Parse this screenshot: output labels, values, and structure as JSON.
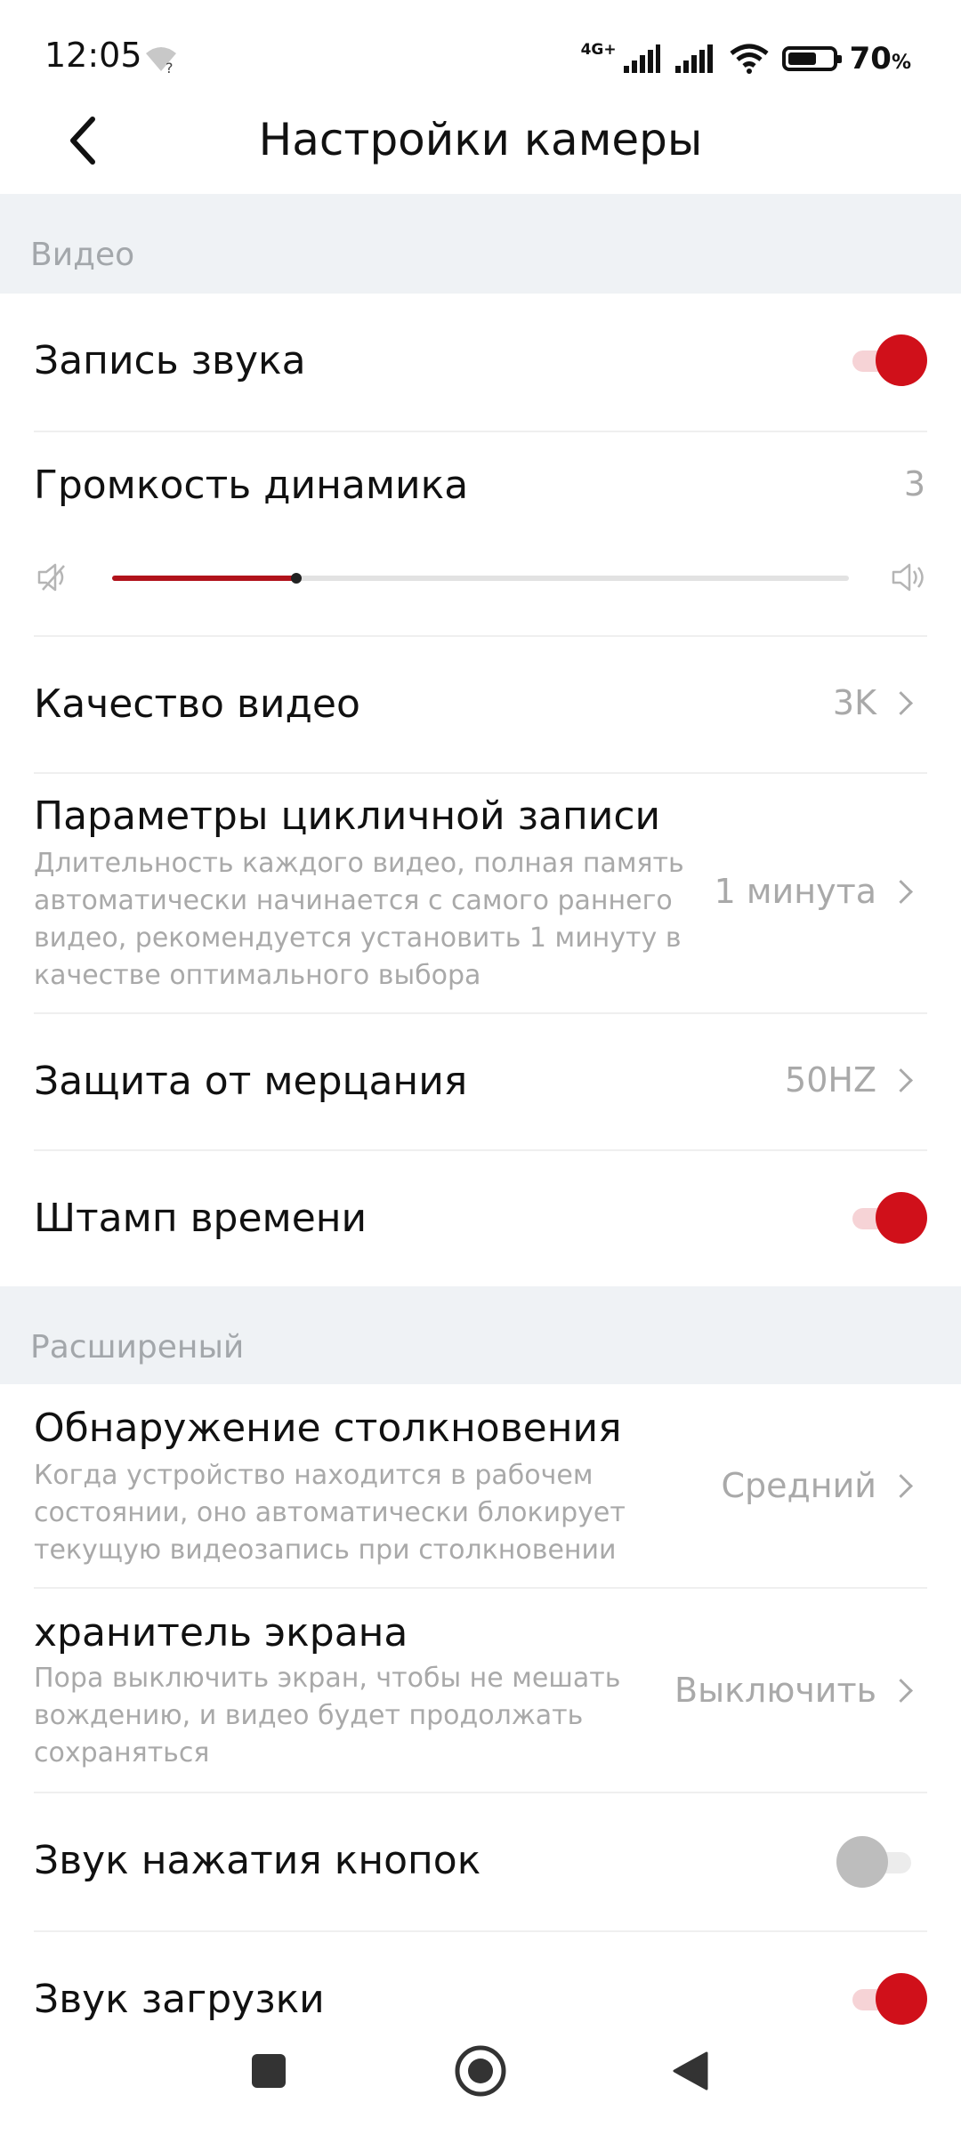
{
  "status_bar": {
    "time": "12:05",
    "network_label": "4G+",
    "battery_percent": "70",
    "battery_unit": "%",
    "battery_level": 0.7
  },
  "header": {
    "title": "Настройки камеры",
    "back_icon": "chevron-left-icon"
  },
  "sections": {
    "video": {
      "label": "Видео",
      "sound_recording": {
        "title": "Запись звука",
        "enabled": true
      },
      "speaker_volume": {
        "title": "Громкость динамика",
        "value": "3",
        "level": 0.25
      },
      "video_quality": {
        "title": "Качество видео",
        "value": "3K"
      },
      "loop_recording": {
        "title": "Параметры цикличной записи",
        "description": "Длительность каждого видео, полная память автоматически начинается с самого раннего видео, рекомендуется установить 1 минуту в качестве оптимального выбора",
        "value": "1 минута"
      },
      "anti_flicker": {
        "title": "Защита от мерцания",
        "value": "50HZ"
      },
      "timestamp": {
        "title": "Штамп времени",
        "enabled": true
      }
    },
    "advanced": {
      "label": "Расширеный",
      "collision_detection": {
        "title": "Обнаружение столкновения",
        "description": "Когда устройство находится в рабочем состоянии, оно автоматически блокирует текущую видеозапись при столкновении",
        "value": "Средний"
      },
      "screensaver": {
        "title": "хранитель экрана",
        "description": "Пора выключить экран, чтобы не мешать вождению, и видео будет продолжать сохраняться",
        "value": "Выключить"
      },
      "button_sound": {
        "title": "Звук нажатия кнопок",
        "enabled": false
      },
      "boot_sound": {
        "title": "Звук загрузки",
        "enabled": true
      }
    }
  },
  "colors": {
    "accent": "#d0101a",
    "section_bg": "#eff2f5",
    "secondary_text": "#a9a9a9"
  }
}
